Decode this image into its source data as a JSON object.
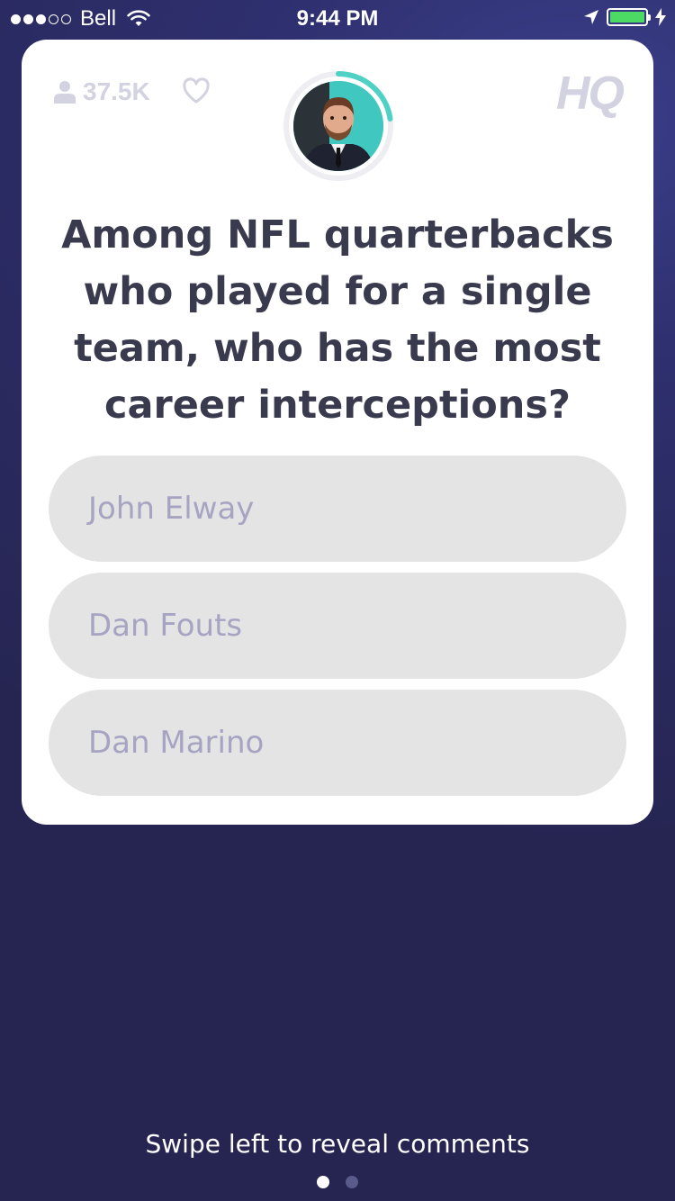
{
  "status_bar": {
    "carrier": "Bell",
    "time": "9:44 PM",
    "signal_bars_filled": 3,
    "signal_bars_total": 5,
    "battery_color": "#4cd964"
  },
  "card": {
    "viewer_count": "37.5K",
    "logo": "HQ",
    "host_timer_color": "#4fd1c5",
    "question": "Among NFL quarterbacks who played for a single team, who has the most career interceptions?",
    "answers": [
      {
        "label": "John Elway"
      },
      {
        "label": "Dan Fouts"
      },
      {
        "label": "Dan Marino"
      }
    ]
  },
  "footer": {
    "swipe_hint": "Swipe left to reveal comments",
    "pages_total": 2,
    "page_active": 1
  }
}
